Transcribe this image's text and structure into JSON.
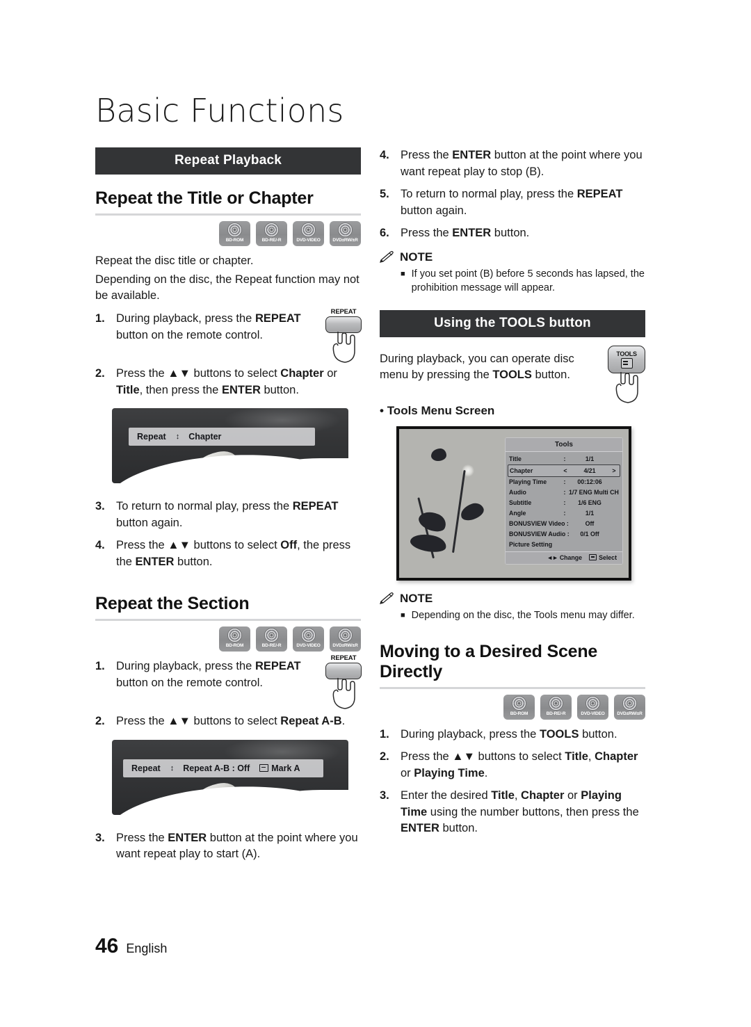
{
  "page": {
    "title": "Basic Functions",
    "number": "46",
    "language": "English"
  },
  "discs": [
    {
      "label": "BD-ROM"
    },
    {
      "label": "BD-RE/-R"
    },
    {
      "label": "DVD-VIDEO"
    },
    {
      "label": "DVD±RW/±R"
    }
  ],
  "left": {
    "band": "Repeat Playback",
    "section1": {
      "heading": "Repeat the Title or Chapter",
      "intro1": "Repeat the disc title or chapter.",
      "intro2": "Depending on the disc, the Repeat function may not be available.",
      "steps": [
        {
          "num": "1.",
          "html": "During playback, press the <b>REPEAT</b> button on the remote control."
        },
        {
          "num": "2.",
          "html": "Press the <b>▲▼</b> buttons to select <b>Chapter</b> or <b>Title</b>, then press the <b>ENTER</b> button."
        },
        {
          "num": "3.",
          "html": "To return to normal play, press the <b>REPEAT</b> button again."
        },
        {
          "num": "4.",
          "html": "Press the <b>▲▼</b> buttons to select <b>Off</b>, the press the <b>ENTER</b> button."
        }
      ],
      "remote_key": "REPEAT",
      "osd": {
        "label": "Repeat",
        "updown": "↕",
        "value": "Chapter"
      }
    },
    "section2": {
      "heading": "Repeat the Section",
      "steps": [
        {
          "num": "1.",
          "html": "During playback, press the <b>REPEAT</b> button on the remote control."
        },
        {
          "num": "2.",
          "html": "Press the <b>▲▼</b> buttons to select <b>Repeat A-B</b>."
        },
        {
          "num": "3.",
          "html": "Press the <b>ENTER</b> button at the point where you want repeat play to start (A)."
        }
      ],
      "remote_key": "REPEAT",
      "osd": {
        "label": "Repeat",
        "updown": "↕",
        "value": "Repeat A-B : Off",
        "action": "Mark A"
      }
    }
  },
  "right": {
    "steps_cont": [
      {
        "num": "4.",
        "html": "Press the <b>ENTER</b> button at the point where you want repeat play to stop (B)."
      },
      {
        "num": "5.",
        "html": "To return to normal play, press the <b>REPEAT</b> button again."
      },
      {
        "num": "6.",
        "html": "Press the <b>ENTER</b> button."
      }
    ],
    "note1": {
      "title": "NOTE",
      "items": [
        "If you set point (B) before 5 seconds has lapsed, the prohibition message will appear."
      ]
    },
    "tools_section": {
      "band": "Using the TOOLS button",
      "intro": "During playback, you can operate disc menu by pressing the TOOLS button.",
      "intro_bold": "TOOLS",
      "remote_key": "TOOLS",
      "screen_caption": "Tools Menu Screen"
    },
    "tools_menu": {
      "title": "Tools",
      "rows": [
        {
          "name": "Title",
          "sep": ":",
          "value": "1/1",
          "selected": false
        },
        {
          "name": "Chapter",
          "sep": "",
          "value": "4/21",
          "selected": true,
          "left_arrow": "<",
          "right_arrow": ">"
        },
        {
          "name": "Playing Time",
          "sep": ":",
          "value": "00:12:06",
          "selected": false
        },
        {
          "name": "Audio",
          "sep": ":",
          "value": "1/7 ENG Multi CH",
          "selected": false
        },
        {
          "name": "Subtitle",
          "sep": ":",
          "value": "1/6 ENG",
          "selected": false
        },
        {
          "name": "Angle",
          "sep": ":",
          "value": "1/1",
          "selected": false
        },
        {
          "name": "BONUSVIEW Video :",
          "sep": "",
          "value": "Off",
          "selected": false
        },
        {
          "name": "BONUSVIEW Audio :",
          "sep": "",
          "value": "0/1 Off",
          "selected": false
        },
        {
          "name": "Picture Setting",
          "sep": "",
          "value": "",
          "selected": false
        }
      ],
      "footer": {
        "change": "Change",
        "select": "Select",
        "change_arrows": "◄►"
      }
    },
    "note2": {
      "title": "NOTE",
      "items": [
        "Depending on the disc, the Tools menu may differ."
      ]
    },
    "section3": {
      "heading": "Moving to a Desired Scene Directly",
      "steps": [
        {
          "num": "1.",
          "html": "During playback, press the <b>TOOLS</b> button."
        },
        {
          "num": "2.",
          "html": "Press the <b>▲▼</b> buttons to select <b>Title</b>, <b>Chapter</b> or <b>Playing Time</b>."
        },
        {
          "num": "3.",
          "html": "Enter the desired <b>Title</b>, <b>Chapter</b> or <b>Playing Time</b> using the number buttons, then press the <b>ENTER</b> button."
        }
      ]
    }
  },
  "colors": {
    "band_bg": "#333436",
    "rule": "#d5d6d8",
    "text": "#1a1a1a",
    "disc_icon": "#8a8b8d"
  }
}
